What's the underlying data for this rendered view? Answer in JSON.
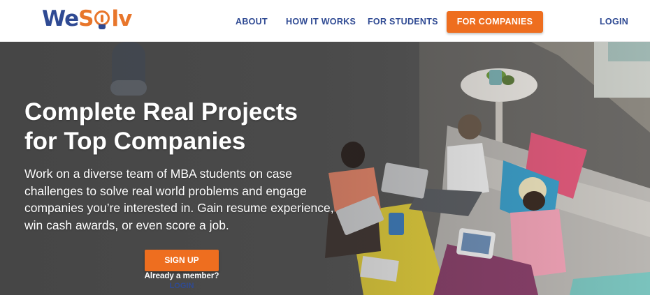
{
  "brand": {
    "logo_we": "We",
    "logo_s": "S",
    "logo_lv": "lv"
  },
  "nav": {
    "items": [
      {
        "label": "ABOUT"
      },
      {
        "label": "HOW IT WORKS"
      },
      {
        "label": "FOR STUDENTS"
      }
    ],
    "cta_label": "FOR COMPANIES",
    "login_label": "LOGIN"
  },
  "hero": {
    "title_line1": "Complete Real Projects",
    "title_line2": "for Top Companies",
    "subtitle": "Work on a diverse team of MBA students on case challenges to solve real world problems and engage companies you’re interested in. Gain resume experience, win cash awards, or even score a job.",
    "signup_label": "SIGN UP",
    "member_text": "Already a member?",
    "member_login": "LOGIN"
  },
  "colors": {
    "brand_blue": "#2f4a93",
    "brand_orange": "#ee6e1f"
  }
}
